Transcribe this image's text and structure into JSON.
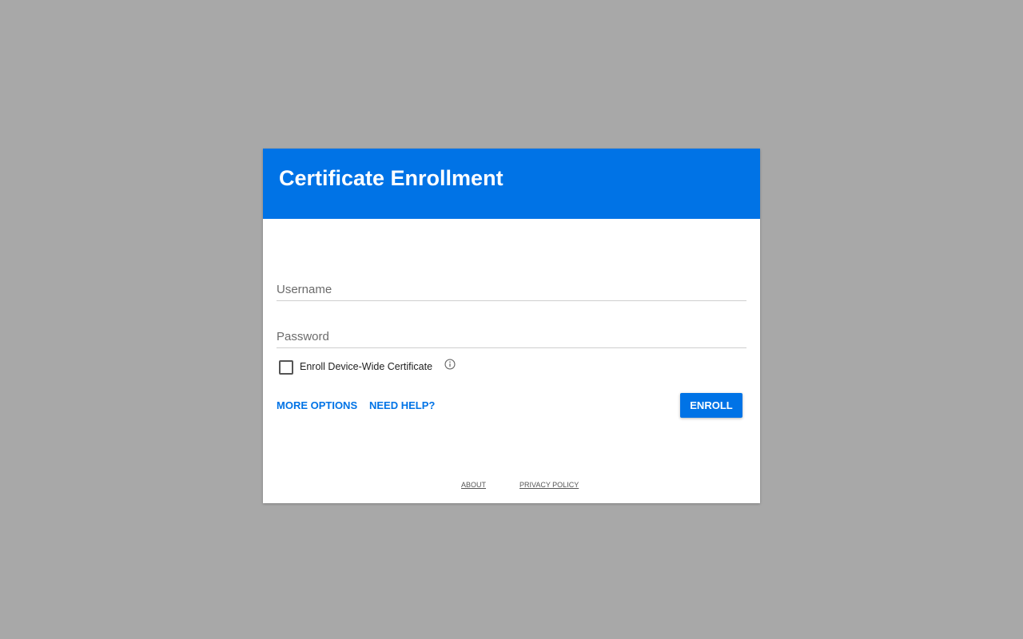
{
  "dialog": {
    "title": "Certificate Enrollment",
    "header_color": "#0073e6"
  },
  "form": {
    "username_placeholder": "Username",
    "password_placeholder": "Password",
    "checkbox_label": "Enroll Device-Wide Certificate",
    "checkbox_checked": false,
    "info_icon": "info-icon"
  },
  "actions": {
    "more_options_label": "MORE OPTIONS",
    "need_help_label": "NEED HELP?",
    "enroll_label": "ENROLL"
  },
  "footer": {
    "about_label": "ABOUT",
    "privacy_label": "PRIVACY POLICY"
  }
}
